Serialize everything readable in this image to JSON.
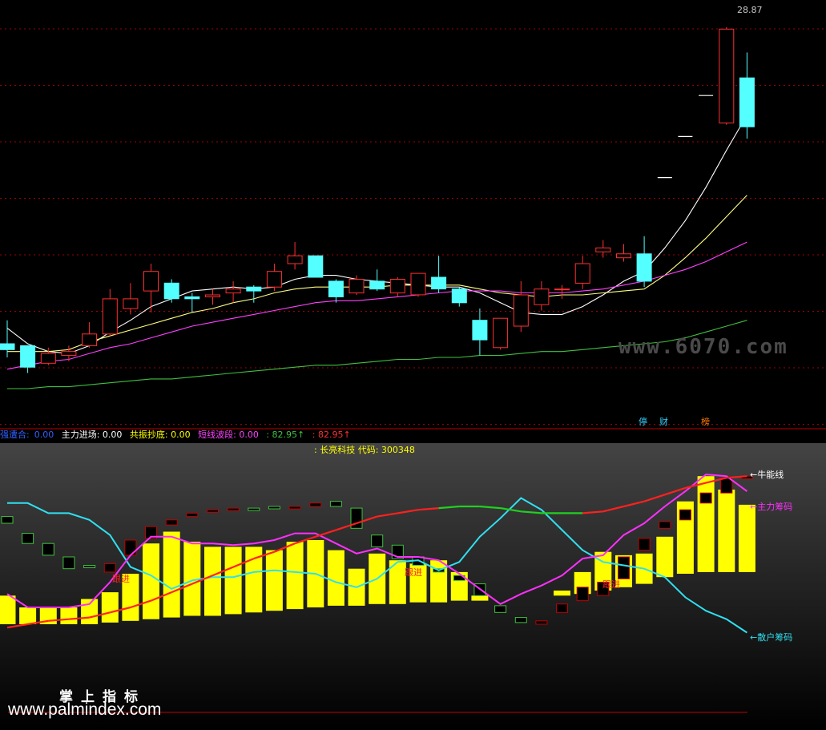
{
  "chart_data": [
    {
      "type": "candlestick",
      "name": "price-panel",
      "price_high_label": "28.87",
      "ylim": [
        9.5,
        30
      ],
      "candles": [
        {
          "o": 12.7,
          "h": 13.9,
          "l": 12.0,
          "c": 12.4
        },
        {
          "o": 12.6,
          "h": 12.6,
          "l": 11.2,
          "c": 11.5
        },
        {
          "o": 11.7,
          "h": 12.5,
          "l": 11.6,
          "c": 12.2
        },
        {
          "o": 12.1,
          "h": 12.6,
          "l": 11.8,
          "c": 12.3
        },
        {
          "o": 12.6,
          "h": 13.8,
          "l": 12.5,
          "c": 13.2
        },
        {
          "o": 13.2,
          "h": 15.5,
          "l": 13.1,
          "c": 15.0
        },
        {
          "o": 14.5,
          "h": 15.8,
          "l": 14.2,
          "c": 15.0
        },
        {
          "o": 15.4,
          "h": 16.8,
          "l": 14.3,
          "c": 16.4
        },
        {
          "o": 15.8,
          "h": 16.0,
          "l": 14.8,
          "c": 15.0
        },
        {
          "o": 15.1,
          "h": 15.3,
          "l": 14.3,
          "c": 15.0
        },
        {
          "o": 15.1,
          "h": 15.5,
          "l": 14.7,
          "c": 15.2
        },
        {
          "o": 15.3,
          "h": 15.9,
          "l": 14.8,
          "c": 15.5
        },
        {
          "o": 15.6,
          "h": 15.7,
          "l": 14.8,
          "c": 15.4
        },
        {
          "o": 15.6,
          "h": 16.8,
          "l": 15.4,
          "c": 16.4
        },
        {
          "o": 16.8,
          "h": 17.9,
          "l": 16.5,
          "c": 17.2
        },
        {
          "o": 17.2,
          "h": 17.2,
          "l": 16.1,
          "c": 16.1
        },
        {
          "o": 15.9,
          "h": 16.0,
          "l": 14.8,
          "c": 15.1
        },
        {
          "o": 15.3,
          "h": 16.2,
          "l": 15.2,
          "c": 16.0
        },
        {
          "o": 15.9,
          "h": 16.5,
          "l": 15.4,
          "c": 15.5
        },
        {
          "o": 15.3,
          "h": 16.1,
          "l": 15.1,
          "c": 16.0
        },
        {
          "o": 15.2,
          "h": 16.3,
          "l": 15.1,
          "c": 16.3
        },
        {
          "o": 16.1,
          "h": 17.2,
          "l": 15.3,
          "c": 15.5
        },
        {
          "o": 15.5,
          "h": 15.6,
          "l": 14.6,
          "c": 14.8
        },
        {
          "o": 13.9,
          "h": 14.5,
          "l": 12.1,
          "c": 12.9
        },
        {
          "o": 12.5,
          "h": 14.0,
          "l": 12.4,
          "c": 14.0
        },
        {
          "o": 13.6,
          "h": 15.9,
          "l": 13.3,
          "c": 15.2
        },
        {
          "o": 14.7,
          "h": 15.9,
          "l": 14.4,
          "c": 15.5
        },
        {
          "o": 15.5,
          "h": 15.7,
          "l": 15.0,
          "c": 15.5
        },
        {
          "o": 15.8,
          "h": 17.2,
          "l": 15.5,
          "c": 16.8
        },
        {
          "o": 17.4,
          "h": 18.0,
          "l": 17.1,
          "c": 17.6
        },
        {
          "o": 17.1,
          "h": 17.8,
          "l": 16.9,
          "c": 17.3
        },
        {
          "o": 17.3,
          "h": 18.2,
          "l": 15.6,
          "c": 15.9
        },
        {
          "o": 21.2,
          "h": 21.2,
          "l": 21.2,
          "c": 21.2
        },
        {
          "o": 23.3,
          "h": 23.3,
          "l": 23.3,
          "c": 23.3
        },
        {
          "o": 25.4,
          "h": 25.4,
          "l": 25.4,
          "c": 25.4
        },
        {
          "o": 24.0,
          "h": 28.9,
          "l": 23.9,
          "c": 28.8
        },
        {
          "o": 26.3,
          "h": 27.6,
          "l": 23.2,
          "c": 23.8
        }
      ],
      "ma_lines": [
        {
          "color": "#ffffff",
          "values": [
            13.5,
            12.7,
            12.3,
            12.2,
            12.6,
            13.3,
            13.9,
            14.6,
            15.0,
            15.4,
            15.5,
            15.6,
            15.5,
            15.6,
            16.0,
            16.2,
            16.2,
            16.0,
            15.9,
            15.8,
            15.7,
            15.6,
            15.6,
            15.3,
            14.8,
            14.3,
            14.2,
            14.2,
            14.6,
            15.2,
            15.9,
            16.4,
            17.6,
            19.0,
            20.7,
            22.6,
            24.4
          ]
        },
        {
          "color": "#ffff80",
          "values": [
            12.3,
            12.3,
            12.3,
            12.4,
            12.8,
            13.1,
            13.4,
            13.7,
            14.0,
            14.3,
            14.5,
            14.8,
            15.0,
            15.3,
            15.5,
            15.6,
            15.6,
            15.6,
            15.6,
            15.7,
            15.7,
            15.7,
            15.7,
            15.5,
            15.3,
            15.2,
            15.1,
            15.2,
            15.2,
            15.3,
            15.4,
            15.5,
            16.2,
            17.1,
            18.1,
            19.2,
            20.3
          ]
        },
        {
          "color": "#ff40ff",
          "values": [
            11.4,
            11.6,
            11.8,
            11.9,
            12.2,
            12.5,
            12.7,
            13.0,
            13.3,
            13.6,
            13.8,
            14.0,
            14.2,
            14.4,
            14.6,
            14.8,
            14.9,
            14.9,
            15.0,
            15.1,
            15.2,
            15.3,
            15.4,
            15.4,
            15.4,
            15.3,
            15.3,
            15.3,
            15.4,
            15.5,
            15.7,
            15.9,
            16.2,
            16.5,
            16.9,
            17.4,
            17.9
          ]
        },
        {
          "color": "#40c040",
          "values": [
            10.4,
            10.4,
            10.5,
            10.5,
            10.6,
            10.7,
            10.8,
            10.9,
            10.9,
            11.0,
            11.1,
            11.2,
            11.3,
            11.4,
            11.5,
            11.6,
            11.6,
            11.7,
            11.8,
            11.9,
            11.9,
            12.0,
            12.0,
            12.1,
            12.1,
            12.2,
            12.3,
            12.3,
            12.4,
            12.5,
            12.6,
            12.7,
            12.8,
            13.0,
            13.3,
            13.6,
            13.9
          ]
        }
      ]
    },
    {
      "type": "indicator",
      "name": "indicator-panel",
      "ylim": [
        0,
        100
      ],
      "yellow_bars": [
        {
          "t": 27,
          "b": 10
        },
        {
          "t": 20,
          "b": 10
        },
        {
          "t": 20,
          "b": 10
        },
        {
          "t": 20,
          "b": 10
        },
        {
          "t": 25,
          "b": 10
        },
        {
          "t": 29,
          "b": 11
        },
        {
          "t": 40,
          "b": 12
        },
        {
          "t": 58,
          "b": 13
        },
        {
          "t": 65,
          "b": 14
        },
        {
          "t": 59,
          "b": 15
        },
        {
          "t": 56,
          "b": 15
        },
        {
          "t": 56,
          "b": 16
        },
        {
          "t": 56,
          "b": 17
        },
        {
          "t": 54,
          "b": 18
        },
        {
          "t": 59,
          "b": 19
        },
        {
          "t": 60,
          "b": 20
        },
        {
          "t": 54,
          "b": 21
        },
        {
          "t": 43,
          "b": 21
        },
        {
          "t": 52,
          "b": 22
        },
        {
          "t": 48,
          "b": 22
        },
        {
          "t": 46,
          "b": 23
        },
        {
          "t": 48,
          "b": 23
        },
        {
          "t": 41,
          "b": 24
        },
        {
          "t": 27,
          "b": 24
        },
        {
          "t": 13,
          "b": 25
        },
        {
          "t": 18,
          "b": 25
        },
        {
          "t": 23,
          "b": 26
        },
        {
          "t": 30,
          "b": 27
        },
        {
          "t": 41,
          "b": 28
        },
        {
          "t": 53,
          "b": 30
        },
        {
          "t": 51,
          "b": 32
        },
        {
          "t": 52,
          "b": 34
        },
        {
          "t": 62,
          "b": 38
        },
        {
          "t": 83,
          "b": 40
        },
        {
          "t": 98,
          "b": 41
        },
        {
          "t": 90,
          "b": 41
        },
        {
          "t": 81,
          "b": 41
        }
      ],
      "boxes": [
        {
          "t": 74,
          "b": 70,
          "c": "#40c040"
        },
        {
          "t": 64,
          "b": 58,
          "c": "#40c040"
        },
        {
          "t": 58,
          "b": 51,
          "c": "#40c040"
        },
        {
          "t": 50,
          "b": 43,
          "c": "#40c040"
        },
        {
          "t": 45,
          "b": 44,
          "c": "#40c040"
        },
        {
          "t": 46,
          "b": 41,
          "c": "#c00000"
        },
        {
          "t": 60,
          "b": 51,
          "c": "#c00000"
        },
        {
          "t": 68,
          "b": 61,
          "c": "#c00000"
        },
        {
          "t": 72,
          "b": 69,
          "c": "#c00000"
        },
        {
          "t": 76,
          "b": 74,
          "c": "#c00000"
        },
        {
          "t": 78,
          "b": 77,
          "c": "#c00000"
        },
        {
          "t": 79,
          "b": 78,
          "c": "#c00000"
        },
        {
          "t": 79,
          "b": 79,
          "c": "#40c040"
        },
        {
          "t": 80,
          "b": 79,
          "c": "#40c040"
        },
        {
          "t": 80,
          "b": 80,
          "c": "#c00000"
        },
        {
          "t": 82,
          "b": 80,
          "c": "#c00000"
        },
        {
          "t": 83,
          "b": 80,
          "c": "#40c040"
        },
        {
          "t": 79,
          "b": 67,
          "c": "#40c040"
        },
        {
          "t": 63,
          "b": 56,
          "c": "#40c040"
        },
        {
          "t": 57,
          "b": 49,
          "c": "#40c040"
        },
        {
          "t": 50,
          "b": 45,
          "c": "#40c040"
        },
        {
          "t": 43,
          "b": 41,
          "c": "#40c040"
        },
        {
          "t": 39,
          "b": 36,
          "c": "#40c040"
        },
        {
          "t": 34,
          "b": 27,
          "c": "#40c040"
        },
        {
          "t": 21,
          "b": 17,
          "c": "#40c040"
        },
        {
          "t": 14,
          "b": 11,
          "c": "#40c040"
        },
        {
          "t": 12,
          "b": 10,
          "c": "#c00000"
        },
        {
          "t": 22,
          "b": 17,
          "c": "#c00000"
        },
        {
          "t": 32,
          "b": 24,
          "c": "#c00000"
        },
        {
          "t": 35,
          "b": 27,
          "c": "#c00000"
        },
        {
          "t": 50,
          "b": 37,
          "c": "#c00000"
        },
        {
          "t": 61,
          "b": 54,
          "c": "#c00000"
        },
        {
          "t": 71,
          "b": 67,
          "c": "#c00000"
        },
        {
          "t": 78,
          "b": 72,
          "c": "#c00000"
        },
        {
          "t": 88,
          "b": 82,
          "c": "#c00000"
        },
        {
          "t": 97,
          "b": 88,
          "c": "#c00000"
        },
        {
          "t": 98,
          "b": 97,
          "c": "#c00000"
        }
      ],
      "niu_line": {
        "values": [
          8,
          10,
          12,
          13,
          14,
          17,
          20,
          24,
          29,
          34,
          39,
          44,
          49,
          53,
          58,
          62,
          66,
          70,
          74,
          76,
          78,
          79,
          80,
          80,
          79,
          77,
          76,
          76,
          76,
          77,
          80,
          83,
          87,
          91,
          94,
          97,
          98
        ],
        "up_color": "#ff2020",
        "down_color": "#20d020",
        "down_range": [
          21,
          28
        ]
      },
      "main_chip": {
        "color": "#ff30ff",
        "values": [
          28,
          20,
          20,
          20,
          22,
          35,
          51,
          62,
          62,
          58,
          58,
          57,
          58,
          60,
          64,
          64,
          58,
          52,
          55,
          50,
          50,
          48,
          40,
          31,
          22,
          28,
          33,
          39,
          49,
          51,
          63,
          70,
          80,
          89,
          99,
          98,
          89
        ]
      },
      "retail_chip": {
        "color": "#30e0f0",
        "values": [
          82,
          82,
          76,
          76,
          72,
          63,
          44,
          39,
          31,
          36,
          38,
          38,
          41,
          42,
          41,
          40,
          35,
          32,
          37,
          47,
          48,
          42,
          47,
          62,
          73,
          85,
          78,
          66,
          54,
          47,
          45,
          43,
          38,
          26,
          18,
          13,
          5
        ]
      }
    }
  ],
  "info_bar": [
    {
      "text": "强遭合:",
      "color": "#3060ff"
    },
    {
      "text": "0.00",
      "color": "#3060ff"
    },
    {
      "text": "主力进场: 0.00",
      "color": "#ffffff"
    },
    {
      "text": "共振抄底: 0.00",
      "color": "#ffff00"
    },
    {
      "text": "短线波段: 0.00",
      "color": "#ff40ff"
    },
    {
      "text": ": 82.95↑",
      "color": "#40c040"
    },
    {
      "text": ": 82.95↑",
      "color": "#ff3030"
    }
  ],
  "stock_label": ": 长亮科技 代码: 300348",
  "price_high": "28.87",
  "tags": [
    {
      "text": "停",
      "color": "#30d0ff"
    },
    {
      "text": "财",
      "color": "#30d0ff"
    },
    {
      "text": "榜",
      "color": "#ff7a00"
    }
  ],
  "legend": {
    "niu": "←牛能线",
    "main": "←主力筹码",
    "retail": "←散户筹码"
  },
  "annotations": [
    "跟进",
    "跟进",
    "跟进"
  ],
  "watermarks": {
    "site1": "www.6070.com",
    "cn": "掌上指标",
    "site2": "www.palmindex.com"
  }
}
